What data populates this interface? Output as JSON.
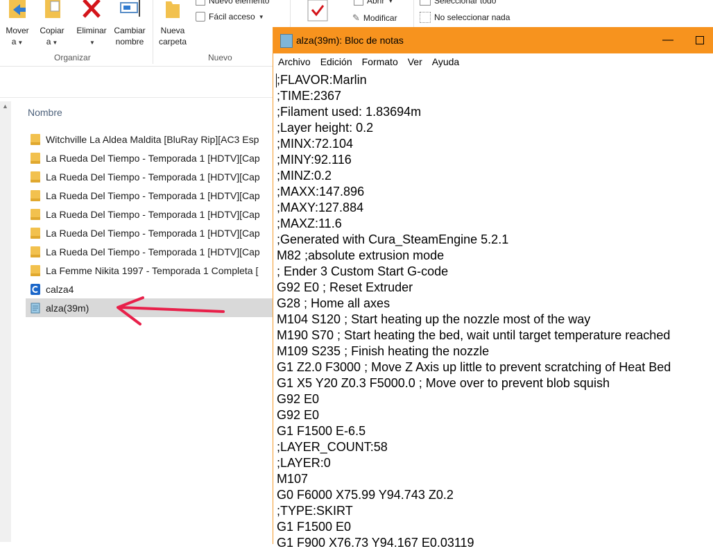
{
  "ribbon": {
    "mover_label": "Mover",
    "mover_sub": "a",
    "copiar_label": "Copiar",
    "copiar_sub": "a",
    "eliminar_label": "Eliminar",
    "cambiar_label1": "Cambiar",
    "cambiar_label2": "nombre",
    "nueva_label1": "Nueva",
    "nueva_label2": "carpeta",
    "nuevo_elemento": "Nuevo elemento",
    "facil_acceso": "Fácil acceso",
    "abrir": "Abrir",
    "modificar": "Modificar",
    "seleccionar_todo": "Seleccionar todo",
    "no_seleccionar": "No seleccionar nada",
    "group_organizar": "Organizar",
    "group_nuevo": "Nuevo"
  },
  "explorer": {
    "column_name": "Nombre",
    "files": [
      {
        "name": "Witchville La Aldea Maldita [BluRay Rip][AC3 Esp",
        "type": "folder"
      },
      {
        "name": "La Rueda Del Tiempo - Temporada 1 [HDTV][Cap",
        "type": "folder"
      },
      {
        "name": "La Rueda Del Tiempo - Temporada 1 [HDTV][Cap",
        "type": "folder"
      },
      {
        "name": "La Rueda Del Tiempo - Temporada 1 [HDTV][Cap",
        "type": "folder"
      },
      {
        "name": "La Rueda Del Tiempo - Temporada 1 [HDTV][Cap",
        "type": "folder"
      },
      {
        "name": "La Rueda Del Tiempo - Temporada 1 [HDTV][Cap",
        "type": "folder"
      },
      {
        "name": "La Rueda Del Tiempo - Temporada 1 [HDTV][Cap",
        "type": "folder"
      },
      {
        "name": "La Femme Nikita 1997 - Temporada 1 Completa [",
        "type": "folder"
      },
      {
        "name": "calza4",
        "type": "cura"
      },
      {
        "name": "alza(39m)",
        "type": "notepad"
      }
    ]
  },
  "notepad": {
    "title": "alza(39m): Bloc de notas",
    "menu": [
      "Archivo",
      "Edición",
      "Formato",
      "Ver",
      "Ayuda"
    ],
    "lines": [
      ";FLAVOR:Marlin",
      ";TIME:2367",
      ";Filament used: 1.83694m",
      ";Layer height: 0.2",
      ";MINX:72.104",
      ";MINY:92.116",
      ";MINZ:0.2",
      ";MAXX:147.896",
      ";MAXY:127.884",
      ";MAXZ:11.6",
      ";Generated with Cura_SteamEngine 5.2.1",
      "M82 ;absolute extrusion mode",
      "; Ender 3 Custom Start G-code",
      "G92 E0 ; Reset Extruder",
      "G28 ; Home all axes",
      "M104 S120 ; Start heating up the nozzle most of the way",
      "M190 S70 ; Start heating the bed, wait until target temperature reached",
      "M109 S235 ; Finish heating the nozzle",
      "G1 Z2.0 F3000 ; Move Z Axis up little to prevent scratching of Heat Bed",
      "G1 X5 Y20 Z0.3 F5000.0 ; Move over to prevent blob squish",
      "G92 E0",
      "G92 E0",
      "G1 F1500 E-6.5",
      ";LAYER_COUNT:58",
      ";LAYER:0",
      "M107",
      "G0 F6000 X75.99 Y94.743 Z0.2",
      ";TYPE:SKIRT",
      "G1 F1500 E0",
      "G1 F900 X76.73 Y94.167 E0.03119"
    ]
  },
  "colors": {
    "title_bar": "#f7931e",
    "selection": "#d9d9d9",
    "arrow": "#e8204a"
  }
}
